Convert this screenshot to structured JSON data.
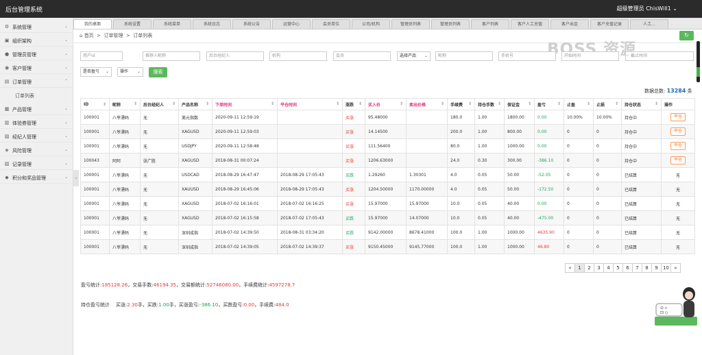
{
  "app": {
    "title": "后台管理系统",
    "user": "超级管理员  ChisWill1 ⌄"
  },
  "sidebar": {
    "items": [
      {
        "label": "系统管理",
        "icon": "gear-icon"
      },
      {
        "label": "组织架构",
        "icon": "org-icon"
      },
      {
        "label": "管理员管理",
        "icon": "user-icon"
      },
      {
        "label": "客户管理",
        "icon": "customer-icon"
      },
      {
        "label": "订单管理",
        "icon": "order-icon"
      },
      {
        "label": "产品管理",
        "icon": "product-icon"
      },
      {
        "label": "体验券管理",
        "icon": "coupon-icon"
      },
      {
        "label": "经纪人管理",
        "icon": "broker-icon"
      },
      {
        "label": "风险管理",
        "icon": "shield-icon"
      },
      {
        "label": "记录管理",
        "icon": "record-icon"
      },
      {
        "label": "积分和奖品管理",
        "icon": "gift-icon"
      }
    ],
    "sub_item": "订单列表"
  },
  "tabs": [
    "我的桌面",
    "系统设置",
    "系统菜单",
    "系统日志",
    "系统公告",
    "运营中心",
    "会员单位",
    "公司/机构",
    "管理员列表",
    "管理员列表",
    "客户列表",
    "客户人工充值",
    "客户出金",
    "客户充值记录",
    "人工..."
  ],
  "breadcrumb": {
    "home": "首页",
    "sep": ">",
    "level1": "订单管理",
    "level2": "订单列表"
  },
  "filters": {
    "user_id": "用户id",
    "referrer_nick": "推荐人昵称",
    "broker": "后台经纪人",
    "institution": "机构",
    "member": "会员",
    "product_select": "选择产品",
    "nickname": "昵称",
    "phone": "手机号",
    "start_time": "开始时间",
    "end_time": "截止时间",
    "profit_select": "是否盈亏",
    "action_select": "操作",
    "search_button": "搜索"
  },
  "total": {
    "label": "数据总数:",
    "value": "13284",
    "unit": "条"
  },
  "table": {
    "headers": [
      "ID",
      "昵称",
      "后台经纪人",
      "产品名称",
      "下单时间",
      "平仓时间",
      "涨跌",
      "买入价",
      "卖出价格",
      "手续费",
      "持仓手数",
      "保证金",
      "盈亏",
      "止盈",
      "止损",
      "持仓状态",
      "操作"
    ],
    "rows": [
      [
        "100001",
        "八爷漂码",
        "无",
        "美元指数",
        "2020-09-11 12:59:19",
        "",
        "买涨",
        "95.48000",
        "",
        "180.0",
        "1.00",
        "1800.00",
        "0.00",
        "10.00%",
        "10.00%",
        "持仓中",
        "平仓"
      ],
      [
        "100001",
        "八爷漂码",
        "无",
        "XAGUSD",
        "2020-09-11 12:59:03",
        "",
        "买涨",
        "14.14500",
        "",
        "200.0",
        "1.00",
        "800.00",
        "0.00",
        "0",
        "0",
        "持仓中",
        "平仓"
      ],
      [
        "100001",
        "八爷漂码",
        "无",
        "USDJPY",
        "2020-09-11 12:58:48",
        "",
        "买涨",
        "111.56400",
        "",
        "80.0",
        "1.00",
        "1000.00",
        "0.00",
        "0",
        "0",
        "持仓中",
        "平仓"
      ],
      [
        "100043",
        "阿阿",
        "张广胜",
        "XAGUSD",
        "2018-08-31 00:07:24",
        "",
        "买涨",
        "1206.63000",
        "",
        "24.0",
        "0.30",
        "300.00",
        "-386.10",
        "0",
        "0",
        "持仓中",
        "平仓"
      ],
      [
        "100001",
        "八爷漂码",
        "无",
        "USDCAD",
        "2018-08-29 16:47:47",
        "2018-08-29 17:05:43",
        "买跌",
        "1.29260",
        "1.30301",
        "4.0",
        "0.05",
        "50.00",
        "-52.05",
        "0",
        "0",
        "已结算",
        "无"
      ],
      [
        "100001",
        "八爷漂码",
        "无",
        "XAUUSD",
        "2018-08-29 16:45:06",
        "2018-08-29 17:05:43",
        "买涨",
        "1204.50000",
        "1170.00000",
        "4.0",
        "0.05",
        "50.00",
        "-172.50",
        "0",
        "0",
        "已结算",
        "无"
      ],
      [
        "100001",
        "八爷漂码",
        "无",
        "XAGUSD",
        "2018-07-02 16:16:01",
        "2018-07-02 16:16:25",
        "买涨",
        "15.97000",
        "15.97000",
        "10.0",
        "0.05",
        "40.00",
        "0.00",
        "0",
        "0",
        "已结算",
        "无"
      ],
      [
        "100001",
        "八爷漂码",
        "无",
        "XAGUSD",
        "2018-07-02 16:15:58",
        "2018-07-02 17:05:43",
        "买跌",
        "15.97000",
        "14.07000",
        "10.0",
        "0.05",
        "40.00",
        "-475.00",
        "0",
        "0",
        "已结算",
        "无"
      ],
      [
        "100001",
        "八爷漂码",
        "无",
        "深圳成指",
        "2018-07-02 14:39:50",
        "2018-08-31 03:34:20",
        "买跌",
        "9142.00000",
        "8678.41000",
        "100.0",
        "1.00",
        "1000.00",
        "4635.90",
        "0",
        "0",
        "已结算",
        "无"
      ],
      [
        "100001",
        "八爷漂码",
        "无",
        "深圳成指",
        "2018-07-02 14:39:05",
        "2018-07-02 14:39:37",
        "买涨",
        "9150.45000",
        "9145.77000",
        "100.0",
        "1.00",
        "1000.00",
        "46.80",
        "0",
        "0",
        "已结算",
        "无"
      ]
    ]
  },
  "pager": [
    "«",
    "1",
    "2",
    "3",
    "4",
    "5",
    "6",
    "7",
    "8",
    "9",
    "10",
    "»"
  ],
  "stats1": {
    "profit_label": "盈亏统计:",
    "profit": "185128.26",
    "lots_label": "，交易手数:",
    "lots": "46194.35",
    "amount_label": "，交易额统计:",
    "amount": "52746080.00",
    "fee_label": "，手续费统计:",
    "fee": "4597278.7"
  },
  "stats2": {
    "label": "持仓盈亏统计",
    "buy_up_label": "买涨:",
    "buy_up": "2.30",
    "lot_unit": "手，",
    "buy_down_label": "买跌:",
    "buy_down": "1.00",
    "up_pl_label": "手，买涨盈亏:",
    "up_pl": "-386.10",
    "down_pl_label": "，买跌盈亏:",
    "down_pl": "0.00",
    "fee_label": "，手续费:",
    "fee": "484.0"
  },
  "watermark": "BOSS 资源",
  "colors": {
    "green": "#5cb85c",
    "red": "#e53935",
    "link_blue": "#1e6bb8",
    "pink_header": "#e0317a"
  }
}
